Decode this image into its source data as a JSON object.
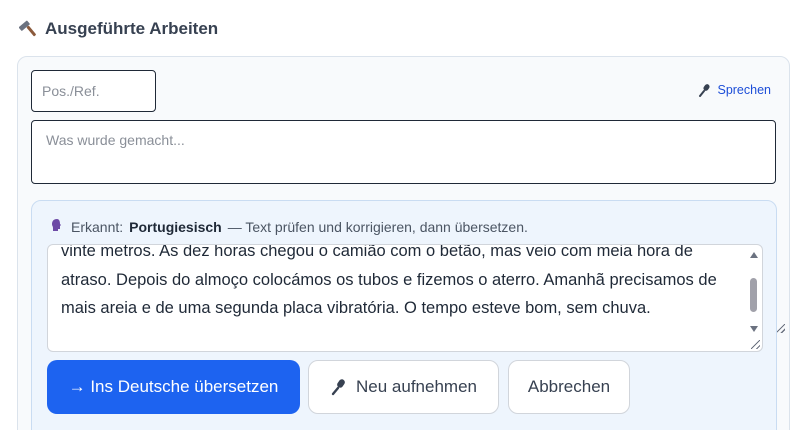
{
  "header": {
    "title": "Ausgeführte Arbeiten",
    "icon": "hammer-icon"
  },
  "form": {
    "pos_placeholder": "Pos./Ref.",
    "pos_value": "",
    "speak_label": "Sprechen",
    "work_placeholder": "Was wurde gemacht...",
    "work_value": ""
  },
  "detection": {
    "prefix": "Erkannt:",
    "language": "Portugiesisch",
    "suffix": "— Text prüfen und korrigieren, dann übersetzen.",
    "transcript": "vinte metros. As dez horas chegou o camião com o betão, mas veio com meia hora de atraso. Depois do almoço colocámos os tubos e fizemos o aterro. Amanhã precisamos de mais areia e de uma segunda placa vibratória. O tempo esteve bom, sem chuva."
  },
  "buttons": {
    "translate": "→ Ins Deutsche übersetzen",
    "record": "Neu aufnehmen",
    "cancel": "Abbrechen"
  },
  "colors": {
    "primary": "#1d63f0",
    "link": "#1d4ed8",
    "detect_bg": "#eef5fd"
  }
}
